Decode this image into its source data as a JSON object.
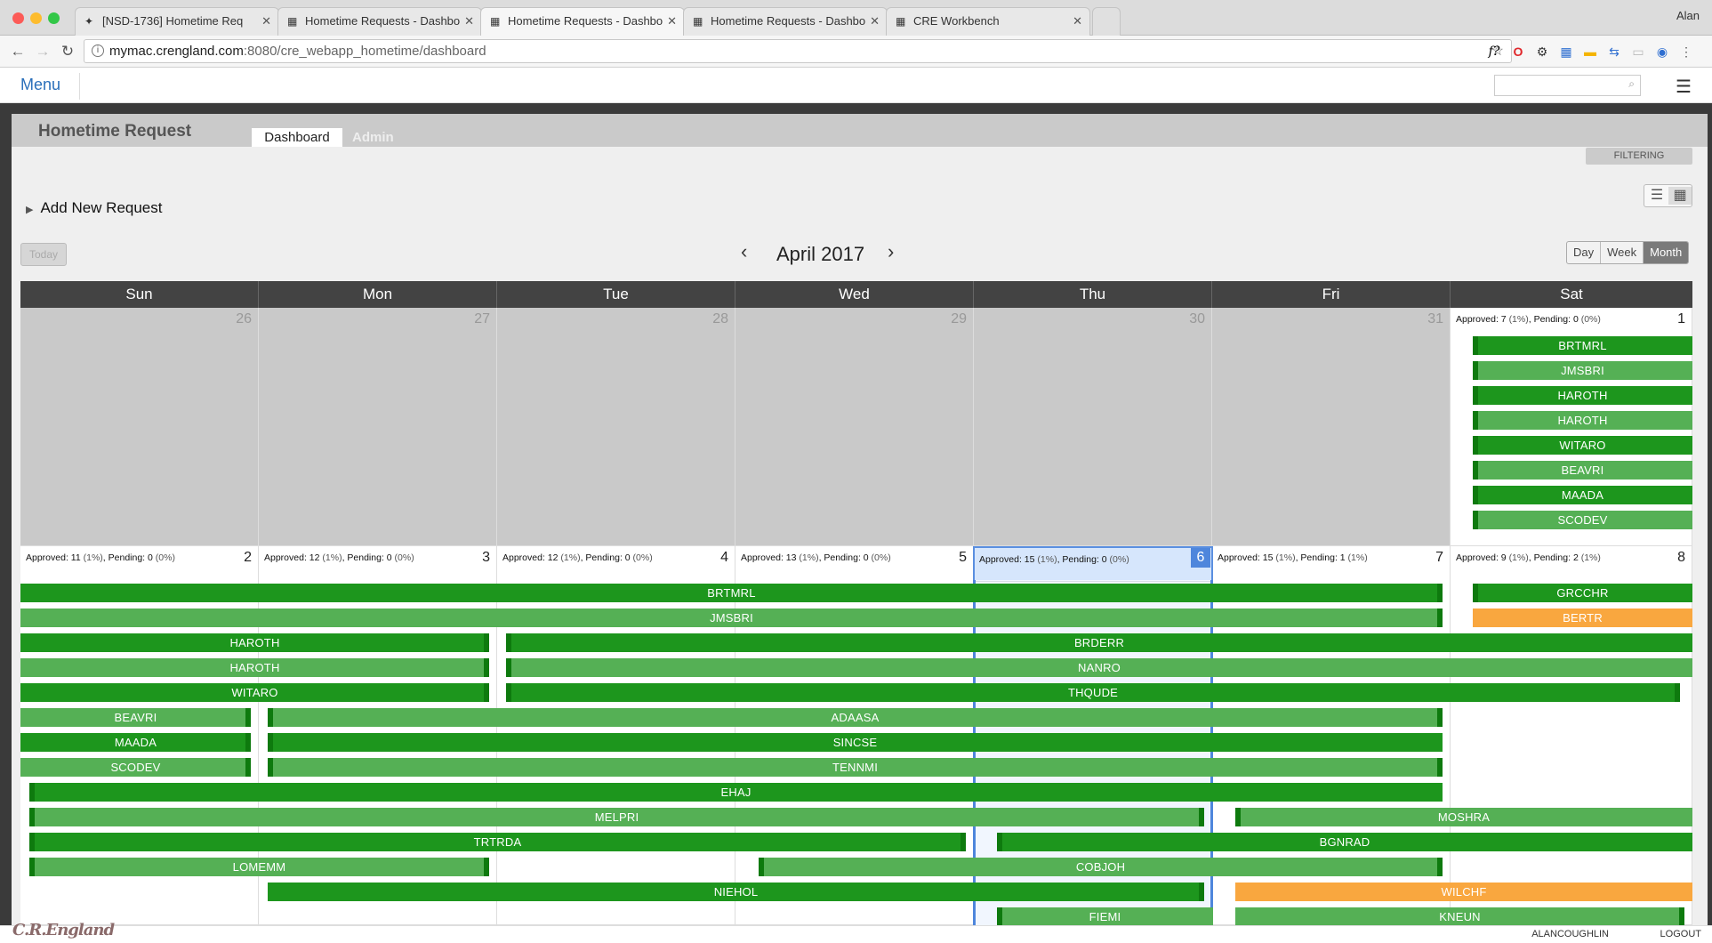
{
  "browser": {
    "tabs": [
      {
        "title": "[NSD-1736] Hometime Req",
        "favicon": "jira-icon"
      },
      {
        "title": "Hometime Requests - Dashbo",
        "favicon": "crengland-icon"
      },
      {
        "title": "Hometime Requests - Dashbo",
        "favicon": "crengland-icon",
        "active": true
      },
      {
        "title": "Hometime Requests - Dashbo",
        "favicon": "crengland-icon"
      },
      {
        "title": "CRE Workbench",
        "favicon": "crengland-icon"
      }
    ],
    "user": "Alan",
    "url_host": "mymac.crengland.com",
    "url_rest": ":8080/cre_webapp_hometime/dashboard"
  },
  "appbar": {
    "menu_label": "Menu",
    "search_placeholder": ""
  },
  "app": {
    "title": "Hometime Request",
    "tabs": {
      "dashboard": "Dashboard",
      "admin": "Admin"
    },
    "filter_label": "FILTERING",
    "add_new_label": "Add New Request",
    "today_label": "Today",
    "month_title": "April 2017",
    "prev_label": "‹",
    "next_label": "›",
    "view_options": {
      "day": "Day",
      "week": "Week",
      "month": "Month",
      "selected": "Month"
    }
  },
  "calendar": {
    "day_names": [
      "Sun",
      "Mon",
      "Tue",
      "Wed",
      "Thu",
      "Fri",
      "Sat"
    ],
    "week1": {
      "days": [
        "26",
        "27",
        "28",
        "29",
        "30",
        "31",
        "1"
      ],
      "sat_stat": {
        "approved": "Approved:",
        "approved_count": "7",
        "approved_pct": "(1%)",
        "pending": "Pending:",
        "pending_count": "0",
        "pending_pct": "(0%)"
      },
      "sat_events": [
        "BRTMRL",
        "JMSBRI",
        "HAROTH",
        "HAROTH",
        "WITARO",
        "BEAVRI",
        "MAADA",
        "SCODEV"
      ]
    },
    "week2": {
      "days": [
        "2",
        "3",
        "4",
        "5",
        "6",
        "7",
        "8"
      ],
      "stats": [
        {
          "approved_count": "11",
          "approved_pct": "(1%)",
          "pending_count": "0",
          "pending_pct": "(0%)"
        },
        {
          "approved_count": "12",
          "approved_pct": "(1%)",
          "pending_count": "0",
          "pending_pct": "(0%)"
        },
        {
          "approved_count": "12",
          "approved_pct": "(1%)",
          "pending_count": "0",
          "pending_pct": "(0%)"
        },
        {
          "approved_count": "13",
          "approved_pct": "(1%)",
          "pending_count": "0",
          "pending_pct": "(0%)"
        },
        {
          "approved_count": "15",
          "approved_pct": "(1%)",
          "pending_count": "0",
          "pending_pct": "(0%)"
        },
        {
          "approved_count": "15",
          "approved_pct": "(1%)",
          "pending_count": "1",
          "pending_pct": "(1%)"
        },
        {
          "approved_count": "9",
          "approved_pct": "(1%)",
          "pending_count": "2",
          "pending_pct": "(1%)"
        }
      ],
      "events": [
        "BRTMRL",
        "GRCCHR",
        "JMSBRI",
        "BERTR",
        "HAROTH",
        "BRDERR",
        "HAROTH",
        "NANRO",
        "WITARO",
        "THQUDE",
        "BEAVRI",
        "ADAASA",
        "MAADA",
        "SINCSE",
        "SCODEV",
        "TENNMI",
        "EHAJ",
        "MELPRI",
        "MOSHRA",
        "TRTRDA",
        "BGNRAD",
        "LOMEMM",
        "COBJOH",
        "NIEHOL",
        "WILCHF",
        "FIEMI",
        "KNEUN"
      ]
    }
  },
  "footer": {
    "logo": "C.R.England",
    "user": "ALANCOUGHLIN",
    "logout": "LOGOUT"
  },
  "colors": {
    "approved_dark": "#1d961d",
    "approved_light": "#55b055",
    "pending": "#f9a73f",
    "today_accent": "#4e86dc"
  }
}
